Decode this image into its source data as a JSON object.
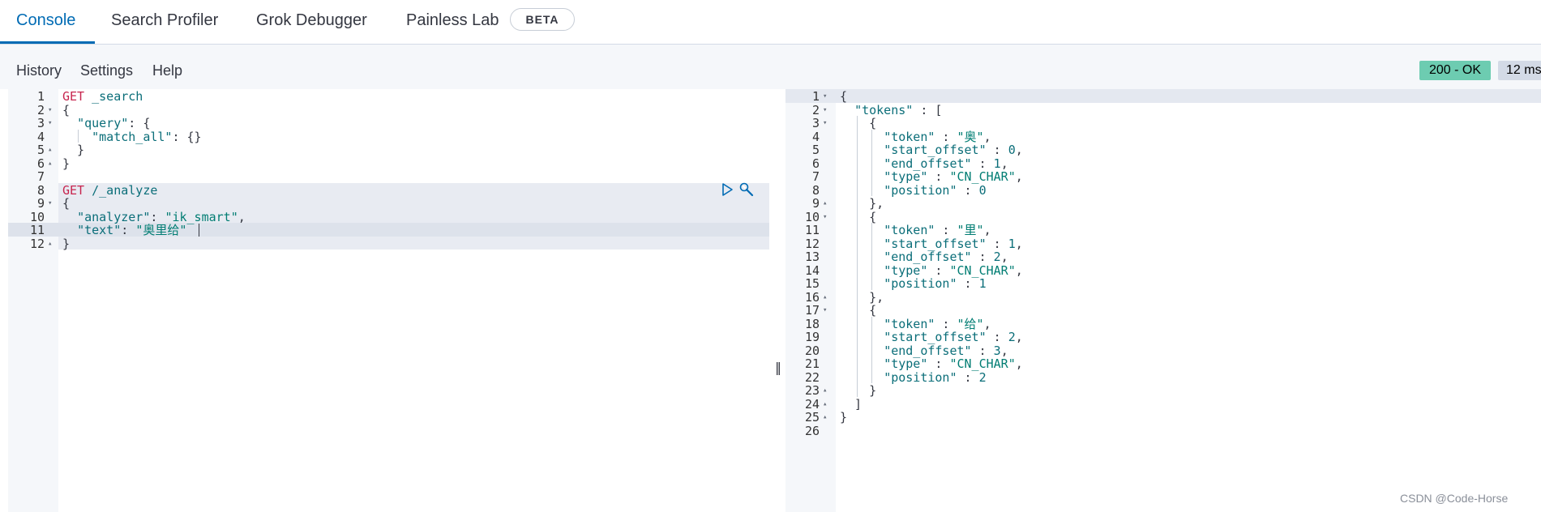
{
  "tabs": [
    {
      "label": "Console",
      "active": true
    },
    {
      "label": "Search Profiler",
      "active": false
    },
    {
      "label": "Grok Debugger",
      "active": false
    },
    {
      "label": "Painless Lab",
      "active": false
    }
  ],
  "beta_badge": "BETA",
  "menu": [
    "History",
    "Settings",
    "Help"
  ],
  "status": {
    "code": "200 - OK",
    "time": "12 ms",
    "color": "#6dccb1"
  },
  "request_lines": [
    "GET _search",
    "{",
    "  \"query\": {",
    "    \"match_all\": {}",
    "  }",
    "}",
    "",
    "GET /_analyze",
    "{",
    "  \"analyzer\": \"ik_smart\",",
    "  \"text\": \"奥里给\"",
    "}"
  ],
  "response_lines": [
    "{",
    "  \"tokens\" : [",
    "    {",
    "      \"token\" : \"奥\",",
    "      \"start_offset\" : 0,",
    "      \"end_offset\" : 1,",
    "      \"type\" : \"CN_CHAR\",",
    "      \"position\" : 0",
    "    },",
    "    {",
    "      \"token\" : \"里\",",
    "      \"start_offset\" : 1,",
    "      \"end_offset\" : 2,",
    "      \"type\" : \"CN_CHAR\",",
    "      \"position\" : 1",
    "    },",
    "    {",
    "      \"token\" : \"给\",",
    "      \"start_offset\" : 2,",
    "      \"end_offset\" : 3,",
    "      \"type\" : \"CN_CHAR\",",
    "      \"position\" : 2",
    "    }",
    "  ]",
    "}",
    ""
  ],
  "icons": {
    "run": "play-icon",
    "wrench": "wrench-icon",
    "resize": "resize-handle-icon"
  },
  "watermark": "CSDN @Code-Horse"
}
